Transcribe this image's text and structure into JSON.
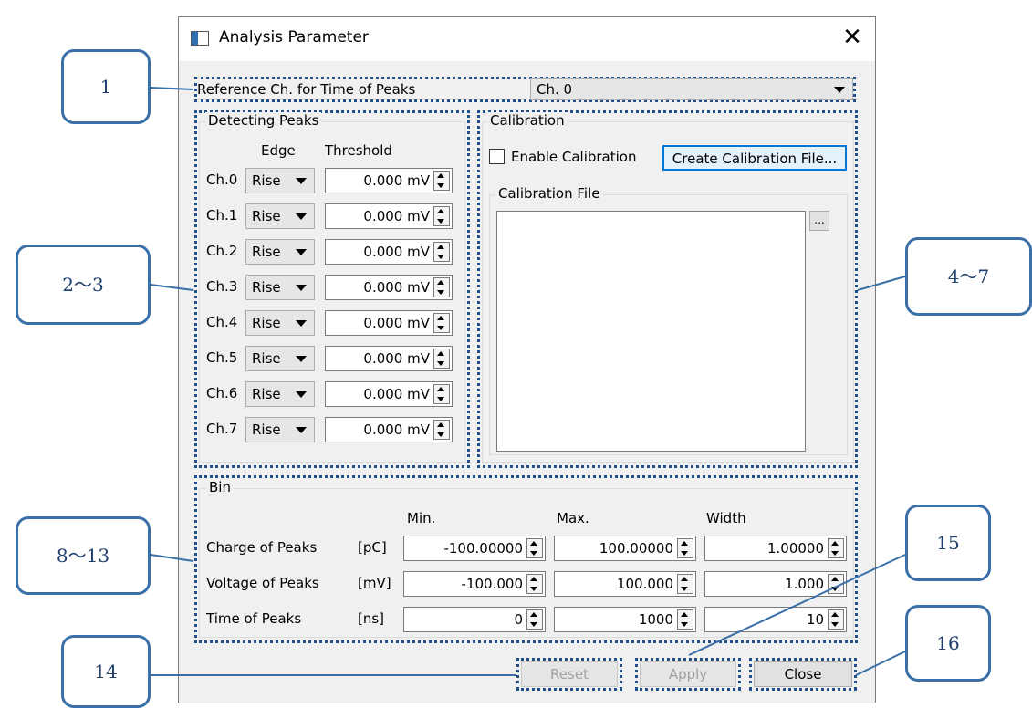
{
  "window": {
    "title": "Analysis Parameter"
  },
  "reference": {
    "label": "Reference Ch. for Time of Peaks",
    "value": "Ch. 0"
  },
  "detecting": {
    "title": "Detecting Peaks",
    "edge_header": "Edge",
    "threshold_header": "Threshold",
    "rows": [
      {
        "ch": "Ch.0",
        "edge": "Rise",
        "threshold": "0.000 mV"
      },
      {
        "ch": "Ch.1",
        "edge": "Rise",
        "threshold": "0.000 mV"
      },
      {
        "ch": "Ch.2",
        "edge": "Rise",
        "threshold": "0.000 mV"
      },
      {
        "ch": "Ch.3",
        "edge": "Rise",
        "threshold": "0.000 mV"
      },
      {
        "ch": "Ch.4",
        "edge": "Rise",
        "threshold": "0.000 mV"
      },
      {
        "ch": "Ch.5",
        "edge": "Rise",
        "threshold": "0.000 mV"
      },
      {
        "ch": "Ch.6",
        "edge": "Rise",
        "threshold": "0.000 mV"
      },
      {
        "ch": "Ch.7",
        "edge": "Rise",
        "threshold": "0.000 mV"
      }
    ]
  },
  "calibration": {
    "title": "Calibration",
    "enable_label": "Enable Calibration",
    "enabled": false,
    "create_button": "Create Calibration File...",
    "file_group": "Calibration File",
    "file_value": "",
    "browse_button": "..."
  },
  "bin": {
    "title": "Bin",
    "headers": {
      "min": "Min.",
      "max": "Max.",
      "width": "Width"
    },
    "rows": [
      {
        "name": "Charge of Peaks",
        "unit": "[pC]",
        "min": "-100.00000",
        "max": "100.00000",
        "width": "1.00000"
      },
      {
        "name": "Voltage of Peaks",
        "unit": "[mV]",
        "min": "-100.000",
        "max": "100.000",
        "width": "1.000"
      },
      {
        "name": "Time of Peaks",
        "unit": "[ns]",
        "min": "0",
        "max": "1000",
        "width": "10"
      }
    ]
  },
  "buttons": {
    "reset": "Reset",
    "apply": "Apply",
    "close": "Close"
  },
  "callouts": [
    "1",
    "2～3",
    "4～7",
    "8～13",
    "14",
    "15",
    "16"
  ],
  "colors": {
    "callout_border": "#3a6fa8",
    "dotted_outline": "#1f4e8c",
    "focus_button": "#0078d7"
  }
}
